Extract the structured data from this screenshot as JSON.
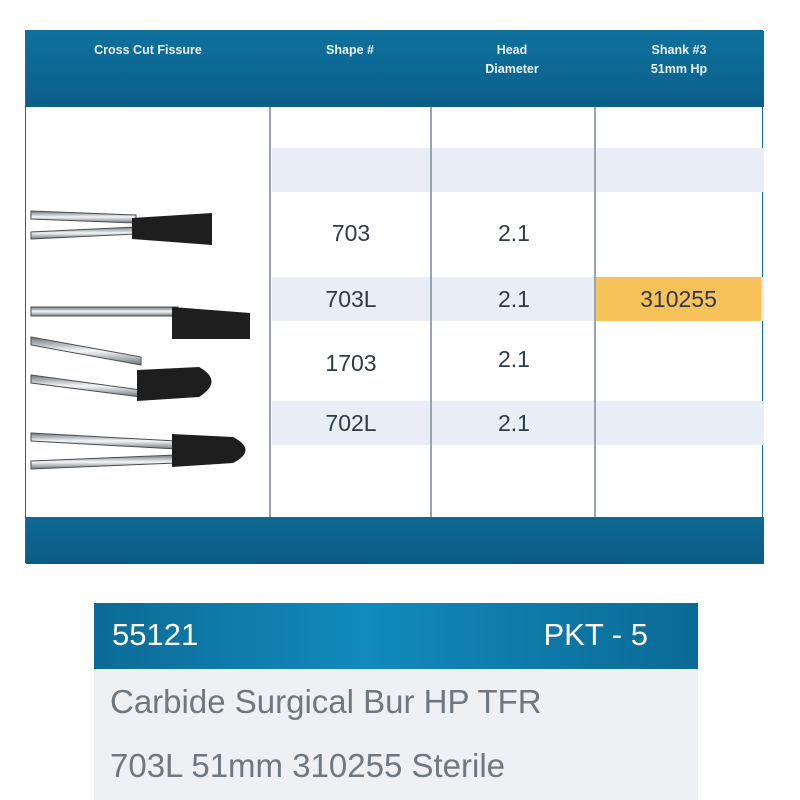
{
  "table": {
    "headers": [
      "Cross Cut Fissure",
      "Shape #",
      "Head\nDiameter",
      "Shank #3\n51mm Hp"
    ],
    "rows": [
      {
        "shape": "703",
        "diameter": "2.1",
        "shank": ""
      },
      {
        "shape": "703L",
        "diameter": "2.1",
        "shank": "310255"
      },
      {
        "shape": "1703",
        "diameter": "2.1",
        "shank": ""
      },
      {
        "shape": "702L",
        "diameter": "2.1",
        "shank": ""
      }
    ],
    "colors": {
      "header": "#0f719e",
      "band": "#e9edf5",
      "highlight": "#f8c25b",
      "text": "#2e3a46"
    },
    "image_icons": [
      "bur-703-icon",
      "bur-703l-icon",
      "bur-1703-icon",
      "bur-702l-icon"
    ]
  },
  "product": {
    "code": "55121",
    "pack": "PKT - 5",
    "description_line1": "Carbide Surgical Bur HP TFR",
    "description_line2": "703L 51mm 310255 Sterile",
    "colors": {
      "header": "#0c6b96",
      "body": "#eef0f3",
      "text": "#6f7780"
    }
  }
}
